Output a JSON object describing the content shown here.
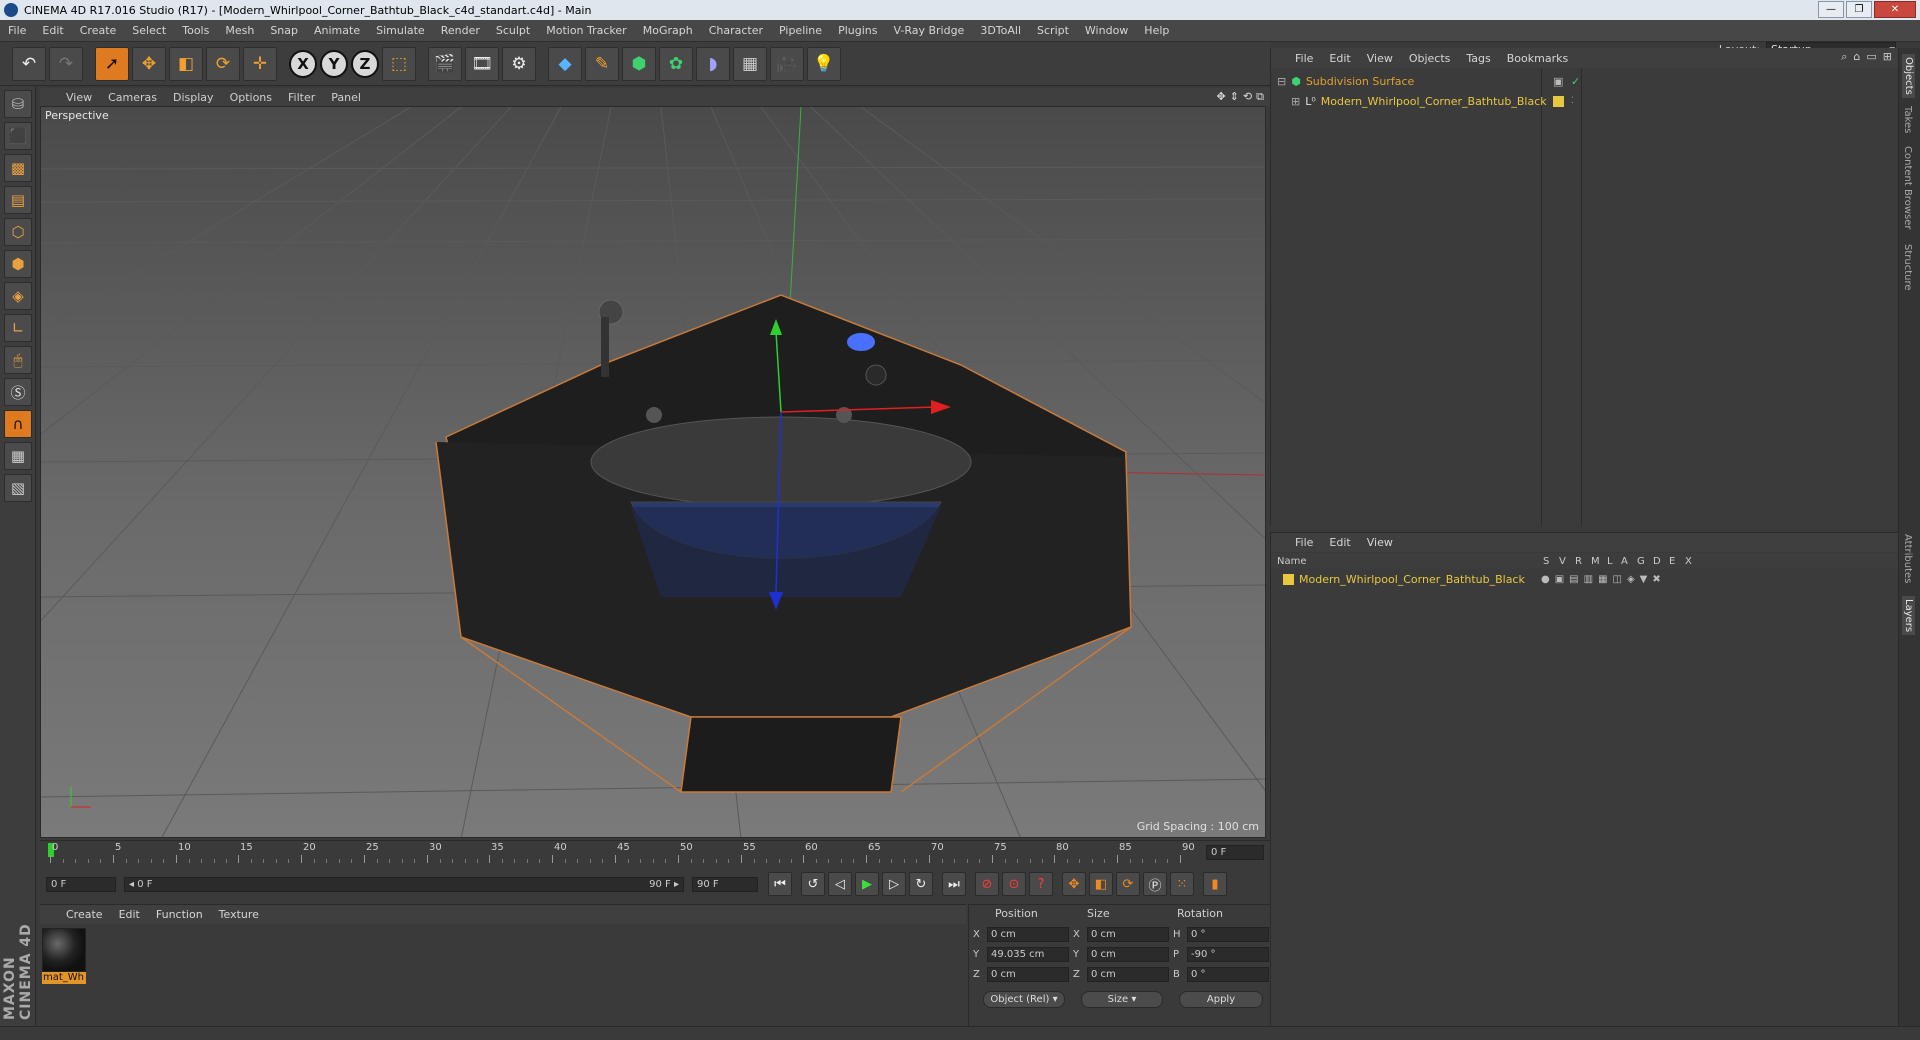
{
  "window": {
    "title": "CINEMA 4D R17.016 Studio (R17) - [Modern_Whirlpool_Corner_Bathtub_Black_c4d_standart.c4d] - Main",
    "controls": [
      "—",
      "❐",
      "✕"
    ]
  },
  "menubar": {
    "items": [
      "File",
      "Edit",
      "Create",
      "Select",
      "Tools",
      "Mesh",
      "Snap",
      "Animate",
      "Simulate",
      "Render",
      "Sculpt",
      "Motion Tracker",
      "MoGraph",
      "Character",
      "Pipeline",
      "Plugins",
      "V-Ray Bridge",
      "3DToAll",
      "Script",
      "Window",
      "Help"
    ],
    "layout_label": "Layout:",
    "layout_value": "Startup"
  },
  "toolbar": {
    "icons": [
      "undo-icon",
      "redo-icon",
      "select-arrow-icon",
      "move-icon",
      "scale-icon",
      "rotate-icon",
      "last-tool-icon",
      "x-axis-icon",
      "y-axis-icon",
      "z-axis-icon",
      "world-coordinate-icon",
      "render-view-icon",
      "render-picture-viewer-icon",
      "edit-render-settings-icon",
      "cube-primitive-icon",
      "pen-spline-icon",
      "subdivision-surface-icon",
      "array-icon",
      "deformer-icon",
      "floor-icon",
      "camera-icon",
      "light-icon"
    ],
    "axis_labels": [
      "X",
      "Y",
      "Z"
    ]
  },
  "viewport": {
    "menu": [
      "View",
      "Cameras",
      "Display",
      "Options",
      "Filter",
      "Panel"
    ],
    "label": "Perspective",
    "grid_spacing": "Grid Spacing : 100 cm"
  },
  "timeline": {
    "ticks": [
      "0",
      "5",
      "10",
      "15",
      "20",
      "25",
      "30",
      "35",
      "40",
      "45",
      "50",
      "55",
      "60",
      "65",
      "70",
      "75",
      "80",
      "85",
      "90"
    ],
    "end_frame": "0 F",
    "current": "0 F",
    "range_start": "◂ 0 F",
    "range_end": "90 F ▸",
    "max_field": "90 F"
  },
  "materials": {
    "menu": [
      "Create",
      "Edit",
      "Function",
      "Texture"
    ],
    "items": [
      {
        "name": "mat_Wh"
      }
    ]
  },
  "coordinates": {
    "headers": [
      "Position",
      "Size",
      "Rotation"
    ],
    "rows": [
      {
        "a": "X",
        "pos": "0 cm",
        "b": "X",
        "size": "0 cm",
        "c": "H",
        "rot": "0 °"
      },
      {
        "a": "Y",
        "pos": "49.035 cm",
        "b": "Y",
        "size": "0 cm",
        "c": "P",
        "rot": "-90 °"
      },
      {
        "a": "Z",
        "pos": "0 cm",
        "b": "Z",
        "size": "0 cm",
        "c": "B",
        "rot": "0 °"
      }
    ],
    "mode": "Object (Rel)",
    "size_mode": "Size",
    "apply": "Apply"
  },
  "objects": {
    "menu": [
      "File",
      "Edit",
      "View",
      "Objects",
      "Tags",
      "Bookmarks"
    ],
    "tree": [
      {
        "name": "Subdivision Surface",
        "color": "#e0a030"
      },
      {
        "name": "Modern_Whirlpool_Corner_Bathtub_Black",
        "color": "#e8c840"
      }
    ]
  },
  "layers": {
    "menu": [
      "File",
      "Edit",
      "View"
    ],
    "columns": [
      "Name",
      "S",
      "V",
      "R",
      "M",
      "L",
      "A",
      "G",
      "D",
      "E",
      "X"
    ],
    "rows": [
      {
        "name": "Modern_Whirlpool_Corner_Bathtub_Black",
        "color": "#e8c840"
      }
    ]
  },
  "side_tabs": [
    "Objects",
    "Takes",
    "Content Browser",
    "Structure",
    "Attributes",
    "Layers"
  ],
  "brand": "MAXON CINEMA 4D",
  "colors": {
    "accent": "#e07a20",
    "layer": "#e8c840",
    "x_axis": "#e03030",
    "y_axis": "#30d030",
    "z_axis": "#3050e0"
  }
}
